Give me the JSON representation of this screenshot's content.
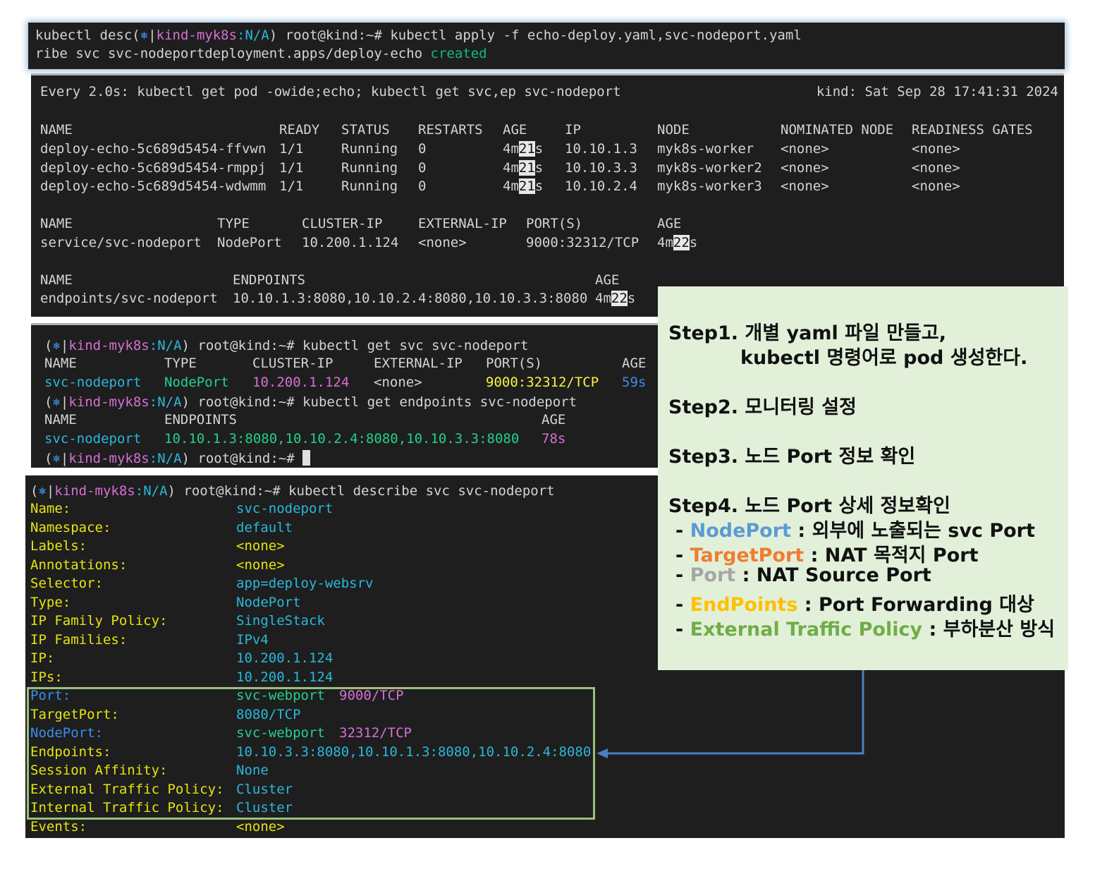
{
  "terminal1": {
    "line1_a": "kubectl desc(",
    "line1_ctx": "kind-myk8s",
    "line1_na": ":N/A",
    "line1_b": ") root@kind:~# kubectl apply -f echo-deploy.yaml,svc-nodeport.yaml",
    "line2_a": "ribe svc svc-nodeportdeployment.apps/deploy-echo ",
    "line2_created": "created"
  },
  "watch": {
    "header": "Every 2.0s: kubectl get pod -owide;echo; kubectl get svc,ep svc-nodeport",
    "host_time": "kind: Sat Sep 28 17:41:31 2024",
    "pods": {
      "headers": [
        "NAME",
        "READY",
        "STATUS",
        "RESTARTS",
        "AGE",
        "IP",
        "NODE",
        "NOMINATED NODE",
        "READINESS GATES"
      ],
      "rows": [
        {
          "name": "deploy-echo-5c689d5454-ffvwn",
          "ready": "1/1",
          "status": "Running",
          "restarts": "0",
          "age_a": "4m",
          "age_b": "21",
          "age_c": "s",
          "ip": "10.10.1.3",
          "node": "myk8s-worker",
          "nominated": "<none>",
          "gates": "<none>"
        },
        {
          "name": "deploy-echo-5c689d5454-rmppj",
          "ready": "1/1",
          "status": "Running",
          "restarts": "0",
          "age_a": "4m",
          "age_b": "21",
          "age_c": "s",
          "ip": "10.10.3.3",
          "node": "myk8s-worker2",
          "nominated": "<none>",
          "gates": "<none>"
        },
        {
          "name": "deploy-echo-5c689d5454-wdwmm",
          "ready": "1/1",
          "status": "Running",
          "restarts": "0",
          "age_a": "4m",
          "age_b": "21",
          "age_c": "s",
          "ip": "10.10.2.4",
          "node": "myk8s-worker3",
          "nominated": "<none>",
          "gates": "<none>"
        }
      ]
    },
    "svc": {
      "headers": [
        "NAME",
        "TYPE",
        "CLUSTER-IP",
        "EXTERNAL-IP",
        "PORT(S)",
        "AGE"
      ],
      "row": {
        "name": "service/svc-nodeport",
        "type": "NodePort",
        "cluster_ip": "10.200.1.124",
        "external_ip": "<none>",
        "ports": "9000:32312/TCP",
        "age_a": "4m",
        "age_b": "22",
        "age_c": "s"
      }
    },
    "ep": {
      "headers": [
        "NAME",
        "ENDPOINTS",
        "AGE"
      ],
      "row": {
        "name": "endpoints/svc-nodeport",
        "endpoints": "10.10.1.3:8080,10.10.2.4:8080,10.10.3.3:8080",
        "age_a": "4m",
        "age_b": "22",
        "age_c": "s"
      }
    }
  },
  "terminal3": {
    "prompt_open": "(",
    "prompt_icon": "⎈",
    "prompt_bar": "|",
    "prompt_ctx": "kind-myk8s",
    "prompt_na": ":N/A",
    "prompt_close": ") root@kind:~# ",
    "cmd1": "kubectl get svc svc-nodeport",
    "svc_headers": [
      "NAME",
      "TYPE",
      "CLUSTER-IP",
      "EXTERNAL-IP",
      "PORT(S)",
      "AGE"
    ],
    "svc_row": {
      "name": "svc-nodeport",
      "type": "NodePort",
      "cluster_ip": "10.200.1.124",
      "external_ip": "<none>",
      "ports": "9000:32312/TCP",
      "age": "59s"
    },
    "cmd2": "kubectl get endpoints svc-nodeport",
    "ep_headers": [
      "NAME",
      "ENDPOINTS",
      "AGE"
    ],
    "ep_row": {
      "name": "svc-nodeport",
      "endpoints": "10.10.1.3:8080,10.10.2.4:8080,10.10.3.3:8080",
      "age": "78s"
    }
  },
  "terminal4": {
    "cmd": "kubectl describe svc svc-nodeport",
    "fields": [
      {
        "label": "Name:",
        "value": "svc-nodeport"
      },
      {
        "label": "Namespace:",
        "value": "default"
      },
      {
        "label": "Labels:",
        "value": "<none>"
      },
      {
        "label": "Annotations:",
        "value": "<none>"
      },
      {
        "label": "Selector:",
        "value": "app=deploy-websrv"
      },
      {
        "label": "Type:",
        "value": "NodePort"
      },
      {
        "label": "IP Family Policy:",
        "value": "SingleStack"
      },
      {
        "label": "IP Families:",
        "value": "IPv4"
      },
      {
        "label": "IP:",
        "value": "10.200.1.124"
      },
      {
        "label": "IPs:",
        "value": "10.200.1.124"
      },
      {
        "label": "Port:",
        "value": "svc-webport",
        "extra": "9000/TCP"
      },
      {
        "label": "TargetPort:",
        "value": "8080/TCP"
      },
      {
        "label": "NodePort:",
        "value": "svc-webport",
        "extra": "32312/TCP"
      },
      {
        "label": "Endpoints:",
        "value": "10.10.3.3:8080,10.10.1.3:8080,10.10.2.4:8080"
      },
      {
        "label": "Session Affinity:",
        "value": "None"
      },
      {
        "label": "External Traffic Policy:",
        "value": "Cluster"
      },
      {
        "label": "Internal Traffic Policy:",
        "value": "Cluster"
      },
      {
        "label": "Events:",
        "value": "<none>"
      }
    ]
  },
  "note": {
    "step1_a": "Step1. 개별 yaml 파일 만들고,",
    "step1_b": "kubectl 명령어로 pod 생성한다.",
    "step2": "Step2. 모니터링 설정",
    "step3": "Step3. 노드 Port 정보 확인",
    "step4": "Step4. 노드 Port 상세 정보확인",
    "dash": "- ",
    "items": [
      {
        "term": "NodePort",
        "desc": " : 외부에 노출되는 svc Port"
      },
      {
        "term": "TargetPort",
        "desc": " : NAT 목적지 Port"
      },
      {
        "term": "Port",
        "desc": " : NAT Source Port"
      },
      {
        "term": "EndPoints",
        "desc": " : Port Forwarding 대상"
      },
      {
        "term": "External Traffic Policy",
        "desc": " : 부하분산 방식"
      }
    ]
  },
  "colors": {
    "terminal_bg": "#1e1e1e",
    "note_bg": "#e2f0d9",
    "highlight_box": "#9bc07a",
    "arrow": "#4a7fc1"
  }
}
